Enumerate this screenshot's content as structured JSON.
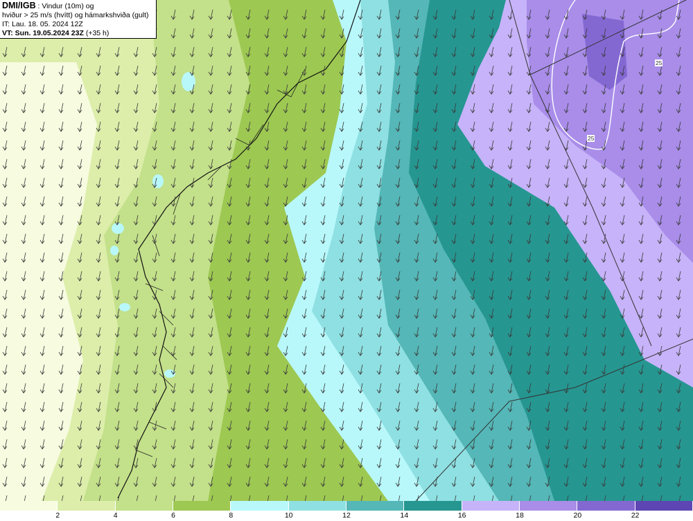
{
  "title": {
    "source": "DMI/IGB",
    "description_line1": " : Vindur (10m) og",
    "description_line2": "hviður > 25 m/s (hvítt) og hámarkshviða (gult)",
    "issue_time": "IT: Lau. 18. 05. 2024 12Z",
    "valid_time_label": "VT: Sun. 19.05.2024 23Z",
    "valid_time_offset": " (+35 h)"
  },
  "colorbar": {
    "bins": [
      {
        "from": 0,
        "to": 2,
        "color": "#f7fbe0"
      },
      {
        "from": 2,
        "to": 4,
        "color": "#dceeaa"
      },
      {
        "from": 4,
        "to": 6,
        "color": "#c3e08a"
      },
      {
        "from": 6,
        "to": 8,
        "color": "#9dc852"
      },
      {
        "from": 8,
        "to": 10,
        "color": "#b8f8fb"
      },
      {
        "from": 10,
        "to": 12,
        "color": "#8fe0e2"
      },
      {
        "from": 12,
        "to": 14,
        "color": "#55b7b7"
      },
      {
        "from": 14,
        "to": 16,
        "color": "#269691"
      },
      {
        "from": 16,
        "to": 18,
        "color": "#c7b3f9"
      },
      {
        "from": 18,
        "to": 20,
        "color": "#a98de9"
      },
      {
        "from": 20,
        "to": 22,
        "color": "#8468d2"
      },
      {
        "from": 22,
        "to": 24,
        "color": "#5e45b4"
      }
    ],
    "tick_labels": [
      "2",
      "4",
      "6",
      "8",
      "10",
      "12",
      "14",
      "16",
      "18",
      "20",
      "22"
    ]
  },
  "contour_labels": [
    "25",
    "25"
  ],
  "wind_direction": "from north (arrows pointing south)"
}
